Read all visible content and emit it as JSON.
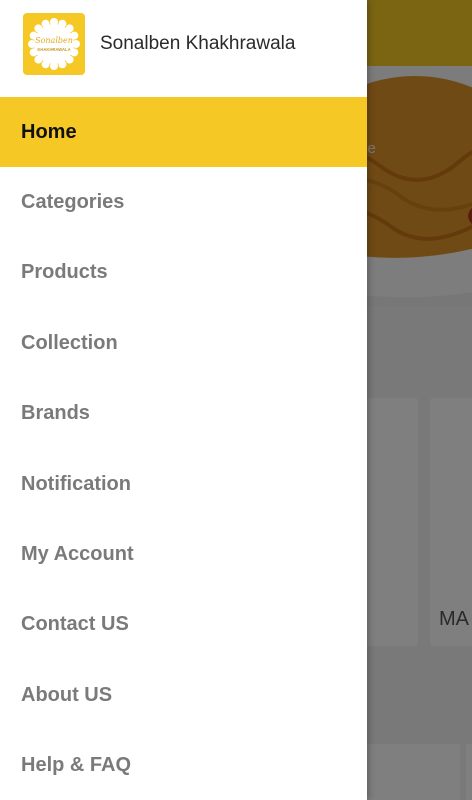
{
  "drawer": {
    "app_name": "Sonalben Khakhrawala",
    "logo_text_top": "Sonalben",
    "logo_text_bottom": "KHAKHRAWALA",
    "items": [
      {
        "label": "Home",
        "active": true
      },
      {
        "label": "Categories",
        "active": false
      },
      {
        "label": "Products",
        "active": false
      },
      {
        "label": "Collection",
        "active": false
      },
      {
        "label": "Brands",
        "active": false
      },
      {
        "label": "Notification",
        "active": false
      },
      {
        "label": "My Account",
        "active": false
      },
      {
        "label": "Contact US",
        "active": false
      },
      {
        "label": "About US",
        "active": false
      },
      {
        "label": "Help & FAQ",
        "active": false
      }
    ]
  },
  "background": {
    "banner_partial_text": "se",
    "card_partial_label": "MA"
  },
  "colors": {
    "accent": "#f6c825",
    "active_text": "#111111",
    "inactive_text": "#7a7a7a"
  }
}
